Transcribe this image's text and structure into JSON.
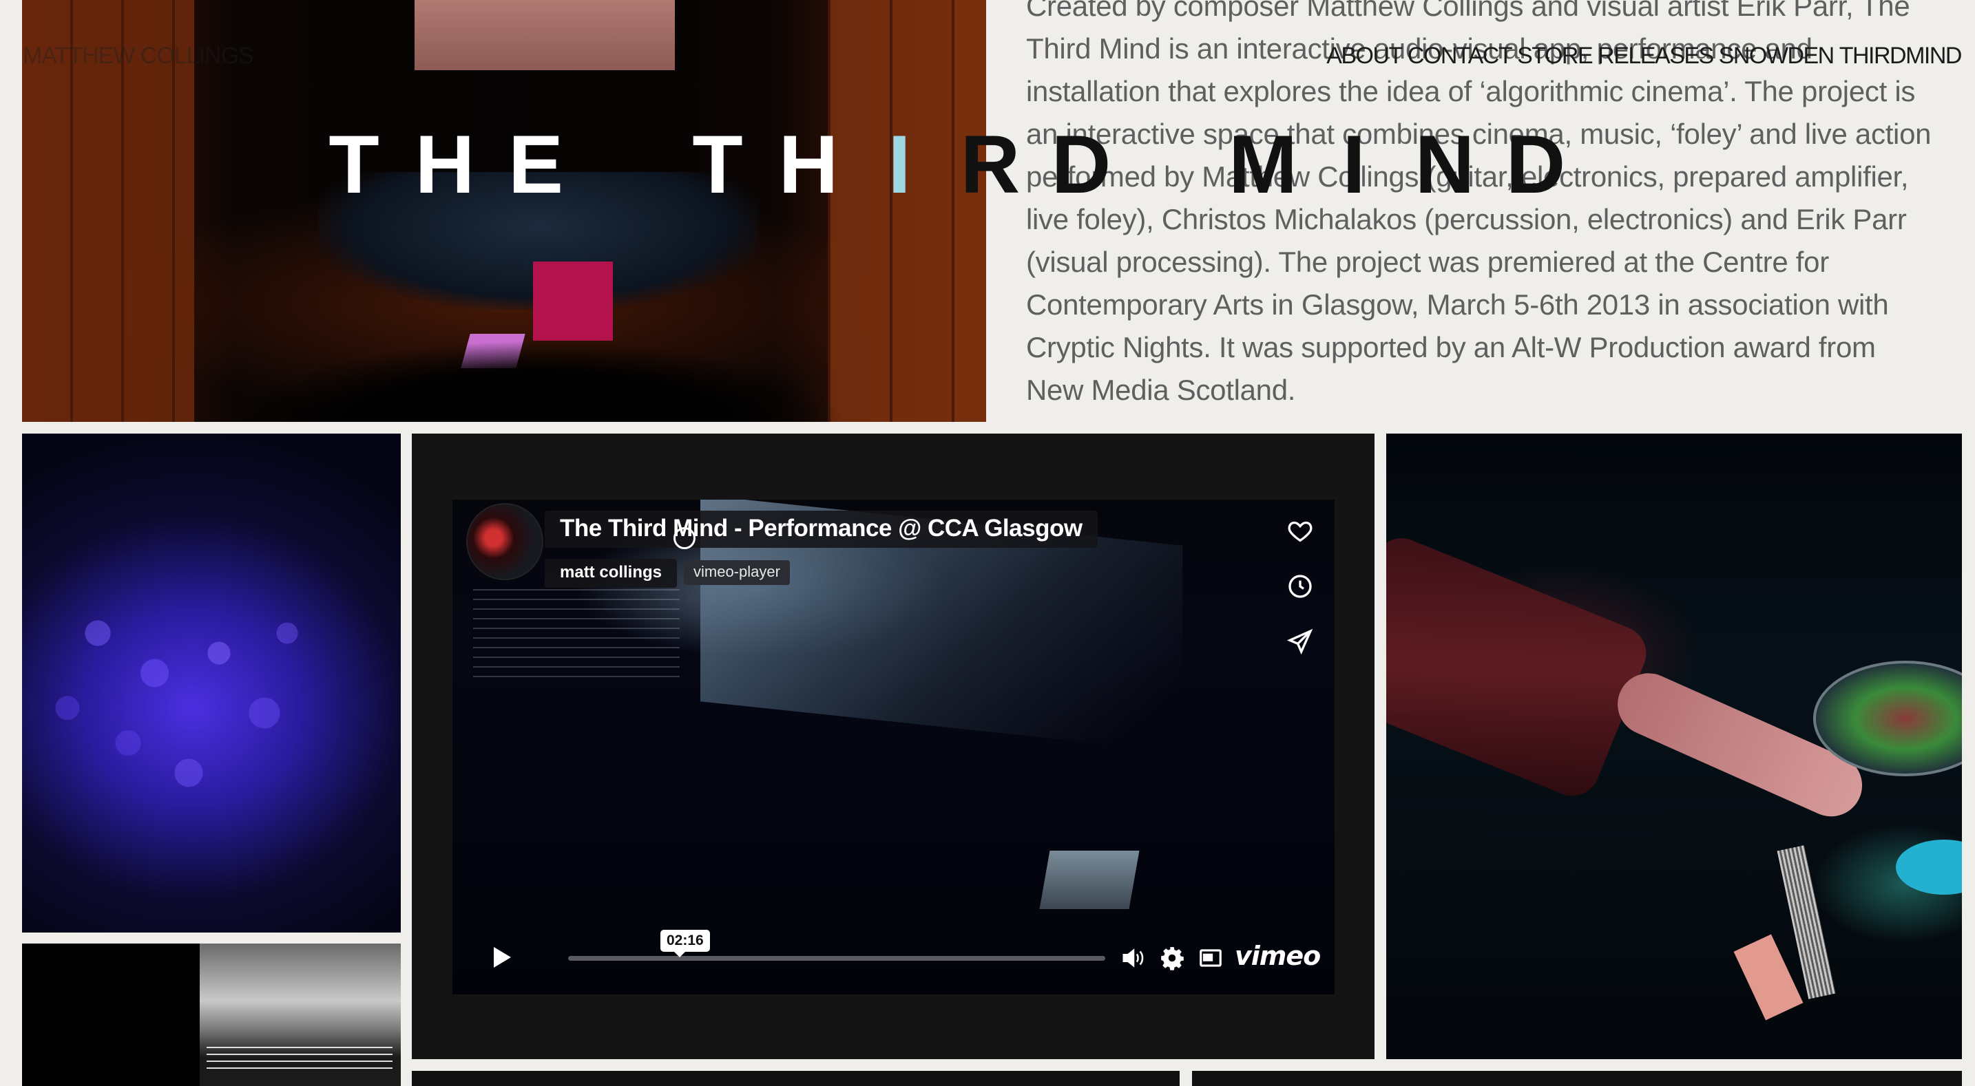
{
  "header": {
    "brand": "MATTHEW COLLINGS",
    "nav": [
      "ABOUT",
      "CONTACT",
      "STORE",
      "RELEASES",
      "SNOWDEN",
      "THIRDMIND"
    ]
  },
  "hero": {
    "title_letters": [
      "T",
      "H",
      "E",
      " ",
      "T",
      "H",
      "I",
      "R",
      "D",
      " ",
      "M",
      "I",
      "N",
      "D"
    ],
    "description": "Created by composer Matthew Collings and visual artist Erik Parr, The Third Mind is an interactive audio-visual app, performance and installation that explores the idea of ‘algorithmic cinema’. The project is an interactive space that combines cinema, music, ‘foley’ and live action performed by Matthew Collings (guitar, electronics, prepared amplifier, live foley), Christos Michalakos (percussion, electronics) and Erik Parr (visual processing). The project was premiered at the Centre for Contemporary Arts in Glasgow, March 5-6th 2013 in association with Cryptic Nights. It was supported by an Alt-W Production award from New Media Scotland."
  },
  "player": {
    "title": "The Third Mind - Performance @ CCA Glasgow",
    "author": "matt collings",
    "tooltip": "vimeo-player",
    "duration": "02:16",
    "progress": 0,
    "logo": "vimeo",
    "icons": {
      "like": "heart-icon",
      "watch_later": "clock-icon",
      "share": "send-icon",
      "play": "play-icon",
      "volume": "volume-icon",
      "settings": "gear-icon",
      "pip": "picture-in-picture-icon"
    }
  },
  "colors": {
    "page_bg": "#efeeea",
    "title_accent": "#9fd8e4"
  }
}
